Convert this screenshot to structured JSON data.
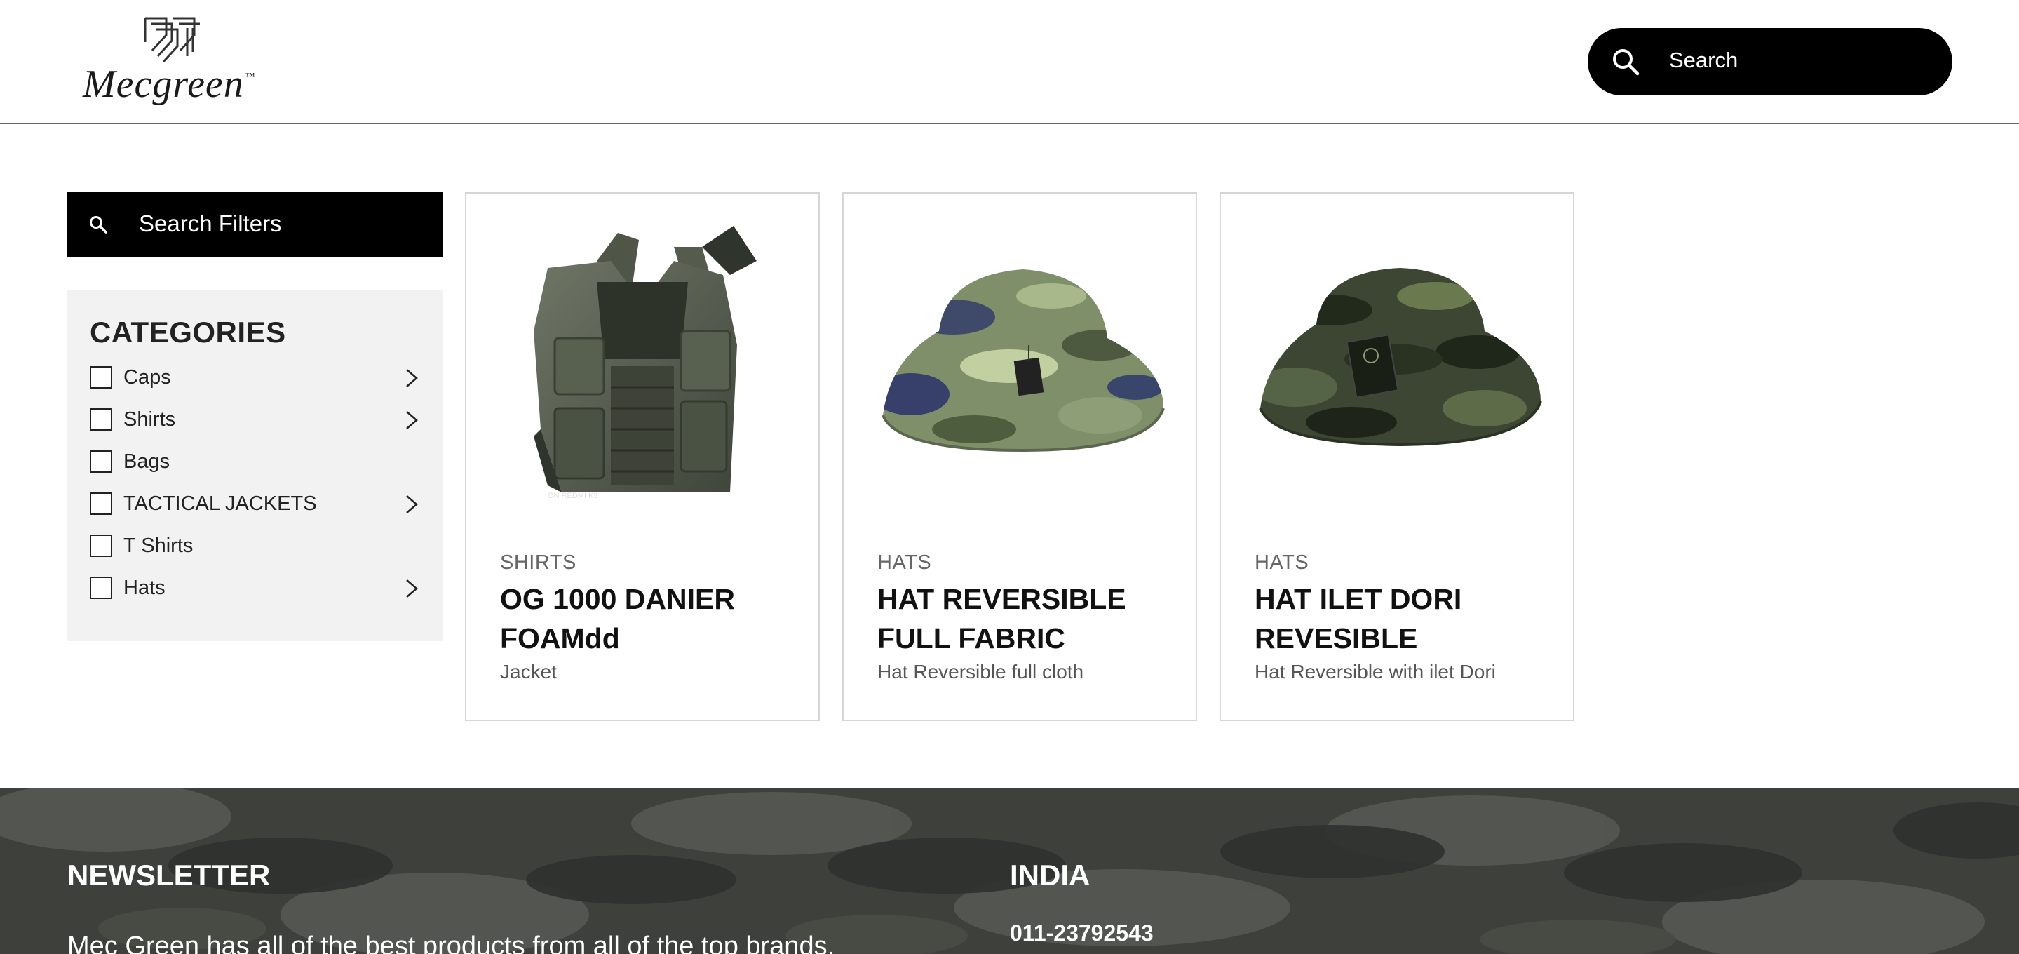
{
  "brand": {
    "name": "Mecgreen",
    "trademark": "™"
  },
  "header": {
    "search_label": "Search"
  },
  "sidebar": {
    "filter_label": "Search Filters",
    "categories_title": "CATEGORIES",
    "categories": [
      {
        "label": "Caps",
        "has_children": true
      },
      {
        "label": "Shirts",
        "has_children": true
      },
      {
        "label": "Bags",
        "has_children": false
      },
      {
        "label": "TACTICAL JACKETS",
        "has_children": true
      },
      {
        "label": "T Shirts",
        "has_children": false
      },
      {
        "label": "Hats",
        "has_children": true
      }
    ]
  },
  "products": [
    {
      "category": "SHIRTS",
      "title": "OG 1000 DANIER FOAMdd",
      "description": "Jacket",
      "image": "tactical-vest-image",
      "image_caption": "ON REDMI K3"
    },
    {
      "category": "HATS",
      "title": "HAT REVERSIBLE FULL FABRIC",
      "description": "Hat Reversible full cloth",
      "image": "camo-bucket-hat-image"
    },
    {
      "category": "HATS",
      "title": "HAT ILET DORI REVESIBLE",
      "description": "Hat Reversible with ilet Dori",
      "image": "dark-camo-bucket-hat-image"
    }
  ],
  "footer": {
    "newsletter_title": "NEWSLETTER",
    "newsletter_text": "Mec Green has all of the best products from all of the top brands.",
    "region_title": "INDIA",
    "phone": "011-23792543"
  },
  "colors": {
    "accent": "#000000",
    "panel": "#f2f2f2",
    "footer": "#3e403c",
    "card_border": "#d6d6d6"
  }
}
